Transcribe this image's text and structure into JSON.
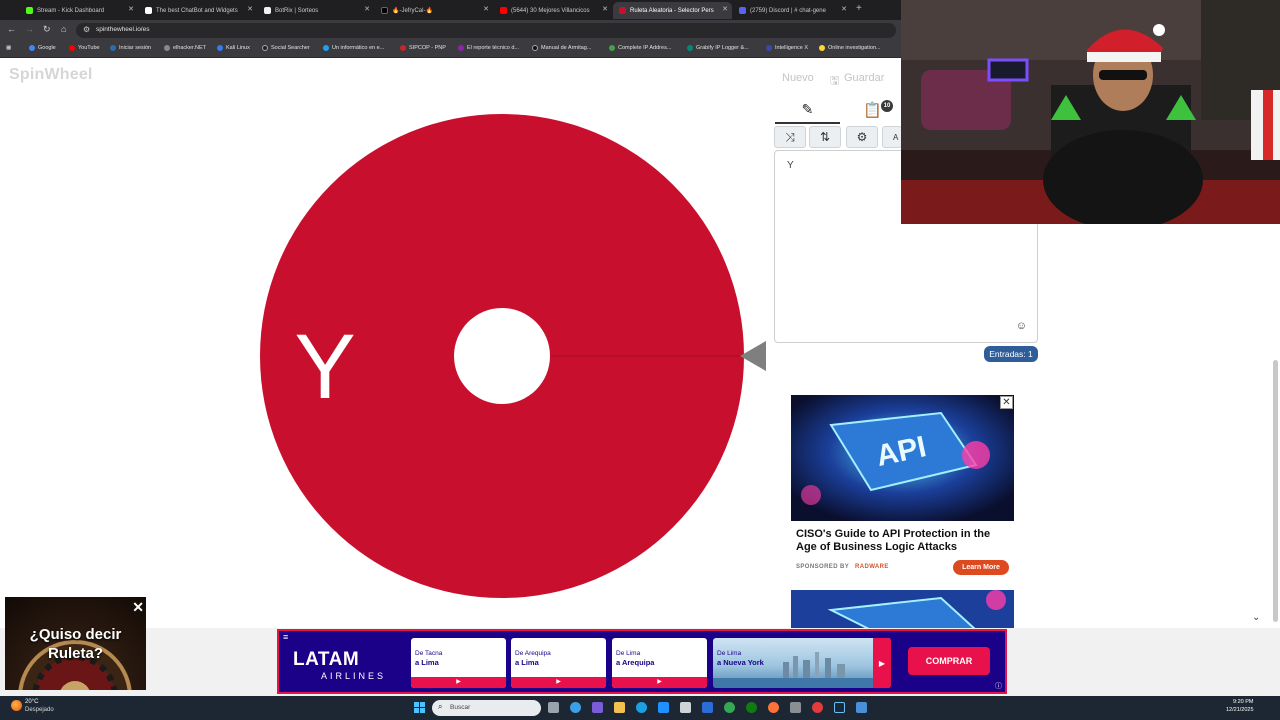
{
  "browser": {
    "tabs": [
      {
        "title": "Stream - Kick Dashboard",
        "color": "#53fc18"
      },
      {
        "title": "The best ChatBot and Widgets",
        "color": "#ffffff"
      },
      {
        "title": "BotRix | Sorteos",
        "color": "#f2f2f2"
      },
      {
        "title": "🔥-JefryCal-🔥",
        "color": "#000000"
      },
      {
        "title": "(5644) 30 Mejores Villancicos",
        "color": "#ff0000"
      },
      {
        "title": "Ruleta Aleatoria - Selector Pers",
        "color": "#c8102e",
        "active": true
      },
      {
        "title": "(2759) Discord | # chat-gene",
        "color": "#5865f2"
      }
    ],
    "new_tab_label": "+",
    "url": "spinthewheel.io/es",
    "bookmarks": [
      {
        "label": "Google",
        "color": "#4285f4"
      },
      {
        "label": "YouTube",
        "color": "#ff0000"
      },
      {
        "label": "Iniciar sesión",
        "color": "#2b6cb0"
      },
      {
        "label": "elhacker.NET",
        "color": "#888888"
      },
      {
        "label": "Kali Linux",
        "color": "#367bf0"
      },
      {
        "label": "Social Searcher",
        "color": "#222222"
      },
      {
        "label": "Un informático en e...",
        "color": "#1da1f2"
      },
      {
        "label": "SIPCOP - PNP",
        "color": "#c62828"
      },
      {
        "label": "El reporte técnico d...",
        "color": "#8e24aa"
      },
      {
        "label": "Manual de Armitag...",
        "color": "#111111"
      },
      {
        "label": "Complete IP Addres...",
        "color": "#43a047"
      },
      {
        "label": "Grabify IP Logger &...",
        "color": "#00897b"
      },
      {
        "label": "Intelligence X",
        "color": "#3949ab"
      },
      {
        "label": "Online investigation...",
        "color": "#fdd835"
      }
    ]
  },
  "site": {
    "logo": "SpinWheel",
    "new_label": "Nuevo",
    "save_label": "Guardar"
  },
  "wheel": {
    "segment_label": "Y",
    "segment_color": "#c8102e",
    "center_color": "#ffffff",
    "pointer_color": "#7f7f7f"
  },
  "editor": {
    "results_count": "10",
    "entries_text": "Y",
    "add_more_label": "A",
    "entries_count_label": "Entradas: 1"
  },
  "ad": {
    "image_text": "API",
    "title": "CISO's Guide to API Protection in the Age of Business Logic Attacks",
    "sponsor_label": "SPONSORED BY",
    "sponsor_name": "RADWARE",
    "cta": "Learn More",
    "close": "✕"
  },
  "roulette_ad": {
    "text": "¿Quiso decir Ruleta?",
    "close": "✕"
  },
  "latam_banner": {
    "logo": "LATAM",
    "subtitle": "AIRLINES",
    "routes": [
      {
        "from": "De Tacna",
        "to": "a Lima"
      },
      {
        "from": "De Arequipa",
        "to": "a Lima"
      },
      {
        "from": "De Lima",
        "to": "a Arequipa"
      }
    ],
    "featured_route": {
      "from": "De Lima",
      "to": "a Nueva York"
    },
    "buy_label": "COMPRAR",
    "play_glyph": "▶"
  },
  "taskbar": {
    "weather_temp": "20°C",
    "weather_desc": "Despejado",
    "search_placeholder": "Buscar",
    "time": "9:20 PM",
    "date": "12/21/2025"
  }
}
